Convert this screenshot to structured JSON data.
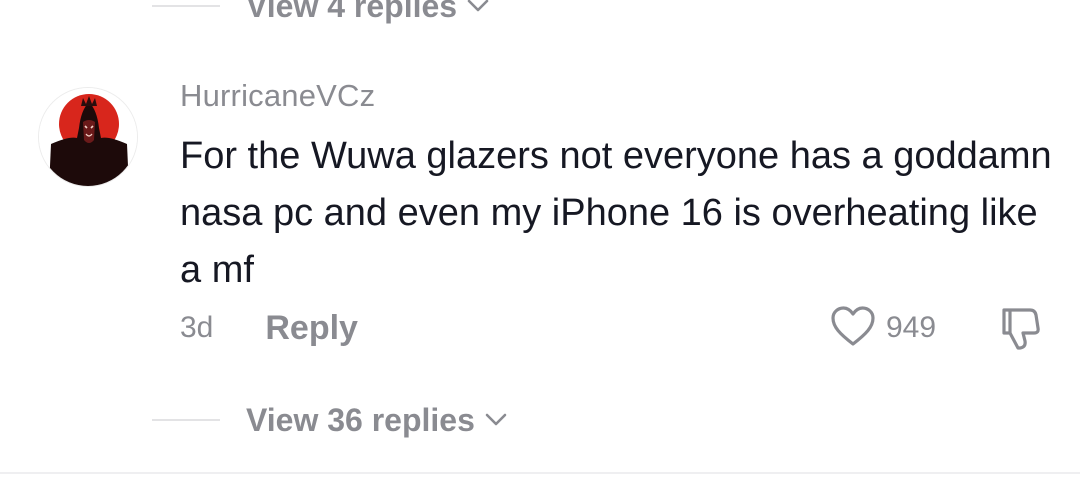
{
  "previous_thread": {
    "view_replies_label": "View 4 replies"
  },
  "comment": {
    "username": "HurricaneVCz",
    "text": "For the Wuwa glazers not everyone has a goddamn nasa pc and even my iPhone 16 is overheating like a mf",
    "timestamp": "3d",
    "reply_label": "Reply",
    "like_count": "949",
    "view_replies_label": "View 36 replies"
  },
  "icons": {
    "like": "heart-outline-icon",
    "dislike": "thumbs-down-outline-icon",
    "expand": "chevron-down-icon"
  },
  "colors": {
    "text_primary": "#161823",
    "text_secondary": "#8a8b91",
    "avatar_red": "#d8261c"
  }
}
